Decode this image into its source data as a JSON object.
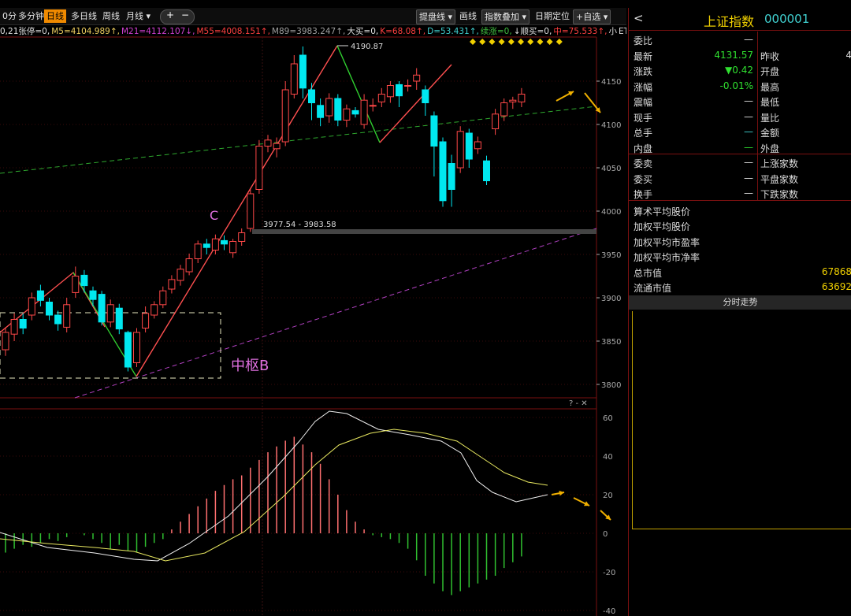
{
  "toolbar": {
    "items": [
      "0分",
      "多分钟",
      "日线",
      "多日线",
      "周线",
      "月线 ▾",
      "提盘线 ▾",
      "画线",
      "指数叠加 ▾",
      "日期定位",
      "+自选 ▾"
    ],
    "active": "日线",
    "plus": "+",
    "minus": "−"
  },
  "indicators": {
    "items": [
      {
        "text": "0,21张停=0,",
        "color": "#e0e0e0"
      },
      {
        "text": "M5=4104.989↑,",
        "color": "#f0d060"
      },
      {
        "text": "M21=4112.107↓,",
        "color": "#d040d0"
      },
      {
        "text": "M55=4008.151↑,",
        "color": "#ff4040"
      },
      {
        "text": "M89=3983.247↑,",
        "color": "#a0a0a0"
      },
      {
        "text": "大买=0,",
        "color": "#e0e0e0"
      },
      {
        "text": "K=68.08↑,",
        "color": "#ff4040"
      },
      {
        "text": "D=53.431↑,",
        "color": "#40d0d0"
      },
      {
        "text": "续涨=0,",
        "color": "#40c040"
      },
      {
        "text": "↓顺买=0,",
        "color": "#e0e0e0"
      },
      {
        "text": "中=75.533↑,",
        "color": "#ff4040"
      },
      {
        "text": "小",
        "color": "#e0e0e0"
      },
      {
        "text": "ETF",
        "color": "#e0e0e0"
      }
    ]
  },
  "chart": {
    "price_ticks": [
      "4150",
      "4100",
      "4050",
      "4000",
      "3950",
      "3900",
      "3850",
      "3800"
    ],
    "sub_ticks": [
      "60",
      "40",
      "20",
      "0",
      "-20",
      "-40"
    ],
    "sub_header": "? - ✕",
    "annotations": {
      "high": "4190.87",
      "range": "3977.54 - 3983.58",
      "c_label": "C",
      "zhongshu": "中枢B"
    },
    "candles": [
      {
        "o": 3840,
        "c": 3860,
        "h": 3866,
        "l": 3833
      },
      {
        "o": 3858,
        "c": 3875,
        "h": 3882,
        "l": 3850
      },
      {
        "o": 3875,
        "c": 3865,
        "h": 3882,
        "l": 3858
      },
      {
        "o": 3880,
        "c": 3900,
        "h": 3906,
        "l": 3874
      },
      {
        "o": 3908,
        "c": 3897,
        "h": 3915,
        "l": 3890
      },
      {
        "o": 3895,
        "c": 3880,
        "h": 3900,
        "l": 3874
      },
      {
        "o": 3880,
        "c": 3870,
        "h": 3885,
        "l": 3862
      },
      {
        "o": 3866,
        "c": 3892,
        "h": 3900,
        "l": 3860
      },
      {
        "o": 3906,
        "c": 3925,
        "h": 3936,
        "l": 3900
      },
      {
        "o": 3926,
        "c": 3914,
        "h": 3932,
        "l": 3906
      },
      {
        "o": 3908,
        "c": 3898,
        "h": 3913,
        "l": 3890
      },
      {
        "o": 3904,
        "c": 3872,
        "h": 3908,
        "l": 3868
      },
      {
        "o": 3872,
        "c": 3892,
        "h": 3898,
        "l": 3866
      },
      {
        "o": 3888,
        "c": 3864,
        "h": 3893,
        "l": 3858
      },
      {
        "o": 3860,
        "c": 3820,
        "h": 3862,
        "l": 3815
      },
      {
        "o": 3825,
        "c": 3860,
        "h": 3865,
        "l": 3820
      },
      {
        "o": 3865,
        "c": 3882,
        "h": 3890,
        "l": 3860
      },
      {
        "o": 3880,
        "c": 3892,
        "h": 3896,
        "l": 3876
      },
      {
        "o": 3892,
        "c": 3908,
        "h": 3913,
        "l": 3888
      },
      {
        "o": 3910,
        "c": 3921,
        "h": 3926,
        "l": 3905
      },
      {
        "o": 3920,
        "c": 3933,
        "h": 3938,
        "l": 3914
      },
      {
        "o": 3930,
        "c": 3945,
        "h": 3951,
        "l": 3926
      },
      {
        "o": 3945,
        "c": 3962,
        "h": 3966,
        "l": 3940
      },
      {
        "o": 3962,
        "c": 3958,
        "h": 3968,
        "l": 3950
      },
      {
        "o": 3955,
        "c": 3968,
        "h": 3973,
        "l": 3950
      },
      {
        "o": 3966,
        "c": 3962,
        "h": 3972,
        "l": 3955
      },
      {
        "o": 3952,
        "c": 3965,
        "h": 3968,
        "l": 3946
      },
      {
        "o": 3965,
        "c": 3975,
        "h": 3980,
        "l": 3960
      },
      {
        "o": 3980,
        "c": 4020,
        "h": 4025,
        "l": 3976
      },
      {
        "o": 4025,
        "c": 4075,
        "h": 4082,
        "l": 4020
      },
      {
        "o": 4075,
        "c": 4082,
        "h": 4088,
        "l": 4068
      },
      {
        "o": 4072,
        "c": 4078,
        "h": 4085,
        "l": 4062
      },
      {
        "o": 4080,
        "c": 4140,
        "h": 4150,
        "l": 4075
      },
      {
        "o": 4135,
        "c": 4170,
        "h": 4180,
        "l": 4130
      },
      {
        "o": 4180,
        "c": 4142,
        "h": 4190,
        "l": 4130
      },
      {
        "o": 4140,
        "c": 4125,
        "h": 4148,
        "l": 4105
      },
      {
        "o": 4122,
        "c": 4108,
        "h": 4130,
        "l": 4098
      },
      {
        "o": 4110,
        "c": 4130,
        "h": 4136,
        "l": 4102
      },
      {
        "o": 4130,
        "c": 4105,
        "h": 4135,
        "l": 4098
      },
      {
        "o": 4105,
        "c": 4118,
        "h": 4123,
        "l": 4097
      },
      {
        "o": 4116,
        "c": 4112,
        "h": 4120,
        "l": 4108
      },
      {
        "o": 4100,
        "c": 4128,
        "h": 4135,
        "l": 4095
      },
      {
        "o": 4122,
        "c": 4122,
        "h": 4130,
        "l": 4115
      },
      {
        "o": 4126,
        "c": 4135,
        "h": 4142,
        "l": 4120
      },
      {
        "o": 4132,
        "c": 4145,
        "h": 4150,
        "l": 4125
      },
      {
        "o": 4146,
        "c": 4133,
        "h": 4150,
        "l": 4120
      },
      {
        "o": 4145,
        "c": 4145,
        "h": 4152,
        "l": 4138
      },
      {
        "o": 4150,
        "c": 4157,
        "h": 4165,
        "l": 4140
      },
      {
        "o": 4140,
        "c": 4125,
        "h": 4145,
        "l": 4110
      },
      {
        "o": 4110,
        "c": 4075,
        "h": 4115,
        "l": 4040
      },
      {
        "o": 4080,
        "c": 4012,
        "h": 4085,
        "l": 4005
      },
      {
        "o": 4055,
        "c": 4025,
        "h": 4065,
        "l": 4005
      },
      {
        "o": 4050,
        "c": 4092,
        "h": 4098,
        "l": 4044
      },
      {
        "o": 4090,
        "c": 4060,
        "h": 4095,
        "l": 4050
      },
      {
        "o": 4072,
        "c": 4080,
        "h": 4086,
        "l": 4066
      },
      {
        "o": 4058,
        "c": 4035,
        "h": 4064,
        "l": 4030
      },
      {
        "o": 4095,
        "c": 4112,
        "h": 4118,
        "l": 4088
      },
      {
        "o": 4110,
        "c": 4125,
        "h": 4130,
        "l": 4104
      },
      {
        "o": 4126,
        "c": 4128,
        "h": 4132,
        "l": 4118
      },
      {
        "o": 4126,
        "c": 4135,
        "h": 4142,
        "l": 4120
      }
    ],
    "macd": [
      -10,
      -8,
      -6,
      -7,
      -5,
      -3,
      -4,
      -2,
      0,
      -1,
      -3,
      -5,
      -8,
      -6,
      -9,
      -10,
      -7,
      -5,
      -3,
      2,
      6,
      10,
      14,
      18,
      22,
      25,
      28,
      30,
      34,
      38,
      42,
      45,
      48,
      50,
      46,
      42,
      36,
      28,
      20,
      12,
      6,
      2,
      -1,
      -2,
      -3,
      -5,
      -8,
      -14,
      -22,
      -26,
      -30,
      -32,
      -30,
      -28,
      -26,
      -24,
      -22,
      -18,
      -15,
      -12
    ]
  },
  "panel": {
    "title": "上证指数",
    "code": "000001",
    "back": "<",
    "rows": [
      {
        "k": "委比",
        "v": "—",
        "c": "#ddd",
        "k2": "",
        "v2": ""
      },
      {
        "k": "最新",
        "v": "4131.57",
        "c": "#30e030",
        "k2": "昨收",
        "v2": "4"
      },
      {
        "k": "涨跌",
        "v": "▼0.42",
        "c": "#30e030",
        "k2": "开盘",
        "v2": ""
      },
      {
        "k": "涨幅",
        "v": "-0.01%",
        "c": "#30e030",
        "k2": "最高",
        "v2": ""
      },
      {
        "k": "震幅",
        "v": "—",
        "c": "#ddd",
        "k2": "最低",
        "v2": ""
      },
      {
        "k": "现手",
        "v": "—",
        "c": "#ddd",
        "k2": "量比",
        "v2": ""
      },
      {
        "k": "总手",
        "v": "—",
        "c": "#40d0d0",
        "k2": "金额",
        "v2": ""
      },
      {
        "k": "内盘",
        "v": "—",
        "c": "#30e030",
        "k2": "外盘",
        "v2": ""
      },
      {
        "k": "委卖",
        "v": "—",
        "c": "#ddd",
        "k2": "上涨家数",
        "v2": ""
      },
      {
        "k": "委买",
        "v": "—",
        "c": "#ddd",
        "k2": "平盘家数",
        "v2": ""
      },
      {
        "k": "换手",
        "v": "—",
        "c": "#ddd",
        "k2": "下跌家数",
        "v2": ""
      }
    ],
    "rows2": [
      {
        "k": "算术平均股价",
        "v": ""
      },
      {
        "k": "加权平均股价",
        "v": ""
      },
      {
        "k": "加权平均市盈率",
        "v": ""
      },
      {
        "k": "加权平均市净率",
        "v": ""
      },
      {
        "k": "总市值",
        "v": "67868"
      },
      {
        "k": "流通市值",
        "v": "63692"
      }
    ],
    "fenshi": "分时走势"
  }
}
